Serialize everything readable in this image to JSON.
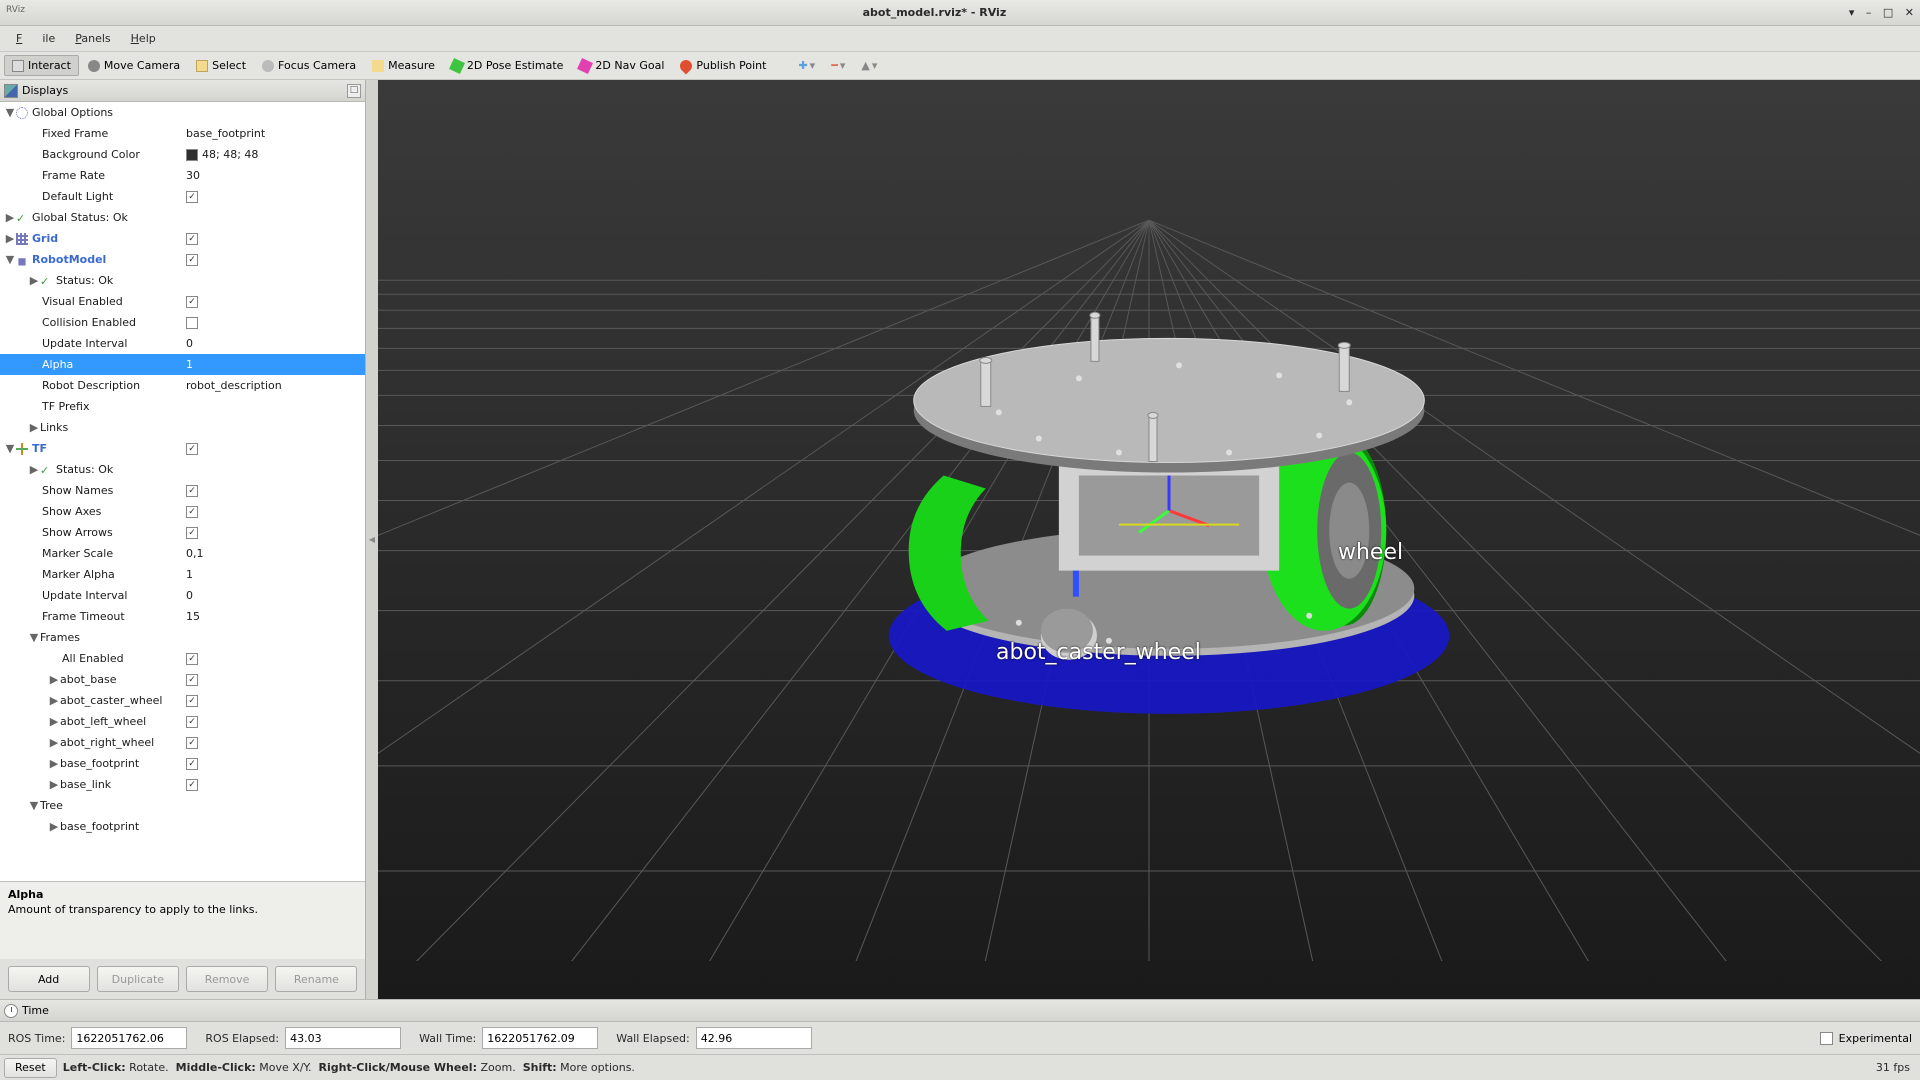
{
  "window": {
    "app_abbr": "RViz",
    "title": "abot_model.rviz* - RViz"
  },
  "menu": {
    "file": "File",
    "panels": "Panels",
    "help": "Help"
  },
  "toolbar": {
    "interact": "Interact",
    "move": "Move Camera",
    "select": "Select",
    "focus": "Focus Camera",
    "measure": "Measure",
    "pose": "2D Pose Estimate",
    "nav": "2D Nav Goal",
    "publish": "Publish Point",
    "plus": "+",
    "minus": "−",
    "cube": "▲"
  },
  "displays": {
    "panel_title": "Displays",
    "global_options": "Global Options",
    "fixed_frame": {
      "k": "Fixed Frame",
      "v": "base_footprint"
    },
    "bg_color": {
      "k": "Background Color",
      "v": "48; 48; 48"
    },
    "frame_rate": {
      "k": "Frame Rate",
      "v": "30"
    },
    "default_light": {
      "k": "Default Light",
      "v": true
    },
    "global_status": "Global Status: Ok",
    "grid": "Grid",
    "grid_v": true,
    "robotmodel": "RobotModel",
    "robotmodel_v": true,
    "rm_status": "Status: Ok",
    "visual_enabled": {
      "k": "Visual Enabled",
      "v": true
    },
    "collision_enabled": {
      "k": "Collision Enabled",
      "v": false
    },
    "update_interval": {
      "k": "Update Interval",
      "v": "0"
    },
    "alpha": {
      "k": "Alpha",
      "v": "1"
    },
    "robot_description": {
      "k": "Robot Description",
      "v": "robot_description"
    },
    "tf_prefix": {
      "k": "TF Prefix",
      "v": ""
    },
    "links": "Links",
    "tf": "TF",
    "tf_v": true,
    "tf_status": "Status: Ok",
    "show_names": {
      "k": "Show Names",
      "v": true
    },
    "show_axes": {
      "k": "Show Axes",
      "v": true
    },
    "show_arrows": {
      "k": "Show Arrows",
      "v": true
    },
    "marker_scale": {
      "k": "Marker Scale",
      "v": "0,1"
    },
    "marker_alpha": {
      "k": "Marker Alpha",
      "v": "1"
    },
    "update_interval2": {
      "k": "Update Interval",
      "v": "0"
    },
    "frame_timeout": {
      "k": "Frame Timeout",
      "v": "15"
    },
    "frames": "Frames",
    "all_enabled": {
      "k": "All Enabled",
      "v": true
    },
    "f_abot_base": {
      "k": "abot_base",
      "v": true
    },
    "f_abot_caster": {
      "k": "abot_caster_wheel",
      "v": true
    },
    "f_abot_left": {
      "k": "abot_left_wheel",
      "v": true
    },
    "f_abot_right": {
      "k": "abot_right_wheel",
      "v": true
    },
    "f_base_footprint": {
      "k": "base_footprint",
      "v": true
    },
    "f_base_link": {
      "k": "base_link",
      "v": true
    },
    "tree": "Tree",
    "tree_bf": "base_footprint"
  },
  "help": {
    "title": "Alpha",
    "body": "Amount of transparency to apply to the links."
  },
  "buttons": {
    "add": "Add",
    "duplicate": "Duplicate",
    "remove": "Remove",
    "rename": "Rename"
  },
  "viewport": {
    "label_caster": "abot_caster_wheel",
    "label_rwheel": "wheel"
  },
  "time_panel": {
    "title": "Time",
    "ros_time_l": "ROS Time:",
    "ros_time_v": "1622051762.06",
    "ros_elapsed_l": "ROS Elapsed:",
    "ros_elapsed_v": "43.03",
    "wall_time_l": "Wall Time:",
    "wall_time_v": "1622051762.09",
    "wall_elapsed_l": "Wall Elapsed:",
    "wall_elapsed_v": "42.96",
    "experimental": "Experimental"
  },
  "status": {
    "reset": "Reset",
    "text": "Left-Click: Rotate.  Middle-Click: Move X/Y.  Right-Click/Mouse Wheel: Zoom.  Shift: More options.",
    "fps": "31 fps"
  }
}
